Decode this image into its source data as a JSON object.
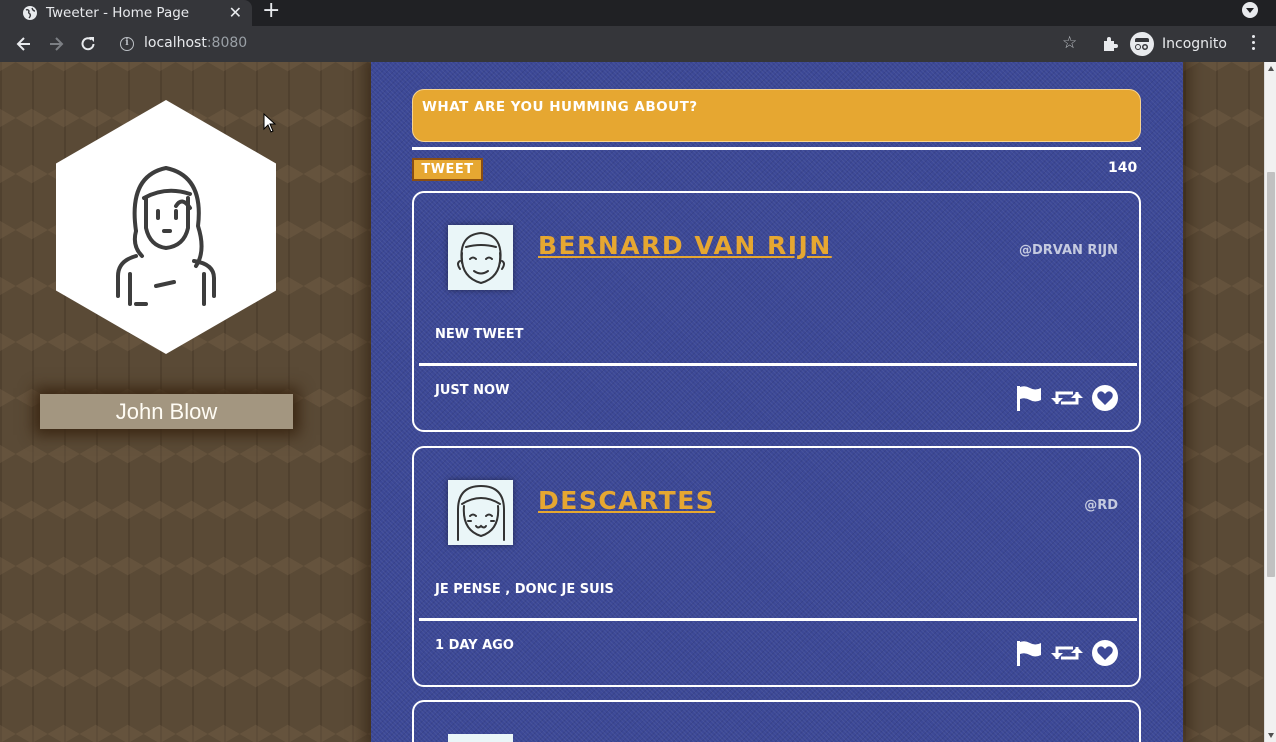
{
  "browser": {
    "tab_title": "Tweeter - Home Page",
    "url_host": "localhost",
    "url_port": ":8080",
    "profile_label": "Incognito"
  },
  "sidebar": {
    "user_name": "John Blow"
  },
  "composer": {
    "prompt": "What are you humming about?",
    "submit_label": "Tweet",
    "char_counter": "140"
  },
  "tweets": [
    {
      "author": "Bernard van Rijn",
      "handle": "@DRvan Rijn",
      "content": "new tweet",
      "time": "just now"
    },
    {
      "author": "Descartes",
      "handle": "@rd",
      "content": "Je pense , donc je suis",
      "time": "1 day ago"
    }
  ],
  "colors": {
    "accent": "#e6a731",
    "main_background": "#3c4896",
    "side_background": "#5a4a36"
  },
  "icons": {
    "flag": "flag-icon",
    "retweet": "retweet-icon",
    "like": "heart-icon"
  }
}
